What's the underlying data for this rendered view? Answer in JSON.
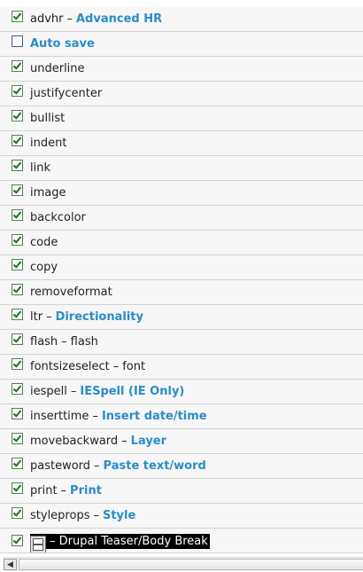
{
  "buttons": [
    {
      "name": "advhr",
      "desc": "Advanced HR",
      "checked": true
    },
    {
      "name": "",
      "desc": "Auto save",
      "checked": false
    },
    {
      "name": "underline",
      "desc": "",
      "checked": true
    },
    {
      "name": "justifycenter",
      "desc": "",
      "checked": true
    },
    {
      "name": "bullist",
      "desc": "",
      "checked": true
    },
    {
      "name": "indent",
      "desc": "",
      "checked": true
    },
    {
      "name": "link",
      "desc": "",
      "checked": true
    },
    {
      "name": "image",
      "desc": "",
      "checked": true
    },
    {
      "name": "backcolor",
      "desc": "",
      "checked": true
    },
    {
      "name": "code",
      "desc": "",
      "checked": true
    },
    {
      "name": "copy",
      "desc": "",
      "checked": true
    },
    {
      "name": "removeformat",
      "desc": "",
      "checked": true
    },
    {
      "name": "ltr",
      "desc": "Directionality",
      "checked": true
    },
    {
      "name": "flash",
      "plain_desc": "flash",
      "checked": true
    },
    {
      "name": "fontsizeselect",
      "plain_desc": "font",
      "checked": true
    },
    {
      "name": "iespell",
      "desc": "IESpell (IE Only)",
      "checked": true
    },
    {
      "name": "inserttime",
      "desc": "Insert date/time",
      "checked": true
    },
    {
      "name": "movebackward",
      "desc": "Layer",
      "checked": true
    },
    {
      "name": "pasteword",
      "desc": "Paste text/word",
      "checked": true
    },
    {
      "name": "print",
      "desc": "Print",
      "checked": true
    },
    {
      "name": "styleprops",
      "desc": "Style",
      "checked": true
    }
  ],
  "teaser": {
    "label": "– Drupal Teaser/Body Break",
    "checked": true,
    "icon": "teaser-break-icon"
  },
  "separator": "–",
  "scrollbar": {
    "left_arrow": "◀",
    "icon": "scroll-left-icon"
  },
  "colors": {
    "link": "#2a8cc8",
    "check": "#117711",
    "row_bg": "#f7f7f7",
    "row_border": "#d4d4d4"
  }
}
